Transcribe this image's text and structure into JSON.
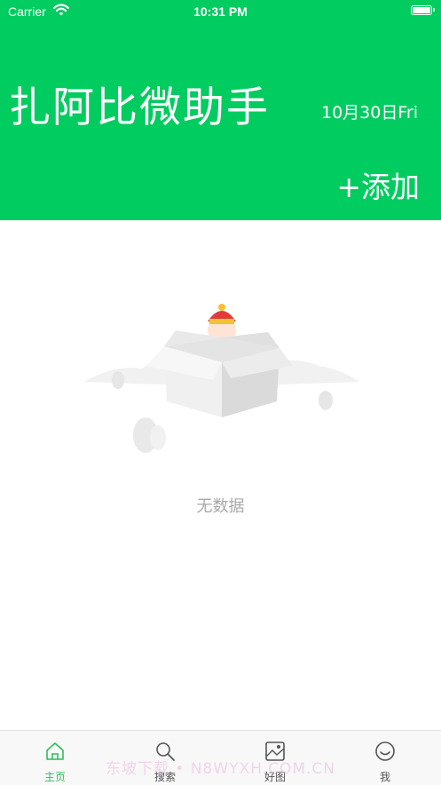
{
  "status_bar": {
    "carrier": "Carrier",
    "time": "10:31 PM"
  },
  "header": {
    "title": "扎阿比微助手",
    "date": "10月30日Fri",
    "add_label": "+添加",
    "background_color": "#00CC5F"
  },
  "empty_state": {
    "text": "无数据"
  },
  "tabbar": {
    "tabs": [
      {
        "label": "主页",
        "icon": "home-icon",
        "active": true
      },
      {
        "label": "搜索",
        "icon": "search-icon",
        "active": false
      },
      {
        "label": "好图",
        "icon": "image-icon",
        "active": false
      },
      {
        "label": "我",
        "icon": "profile-icon",
        "active": false
      }
    ],
    "active_color": "#2EBE5B"
  },
  "watermark": {
    "text": "东坡下载 • N8WYXH.COM.CN"
  }
}
